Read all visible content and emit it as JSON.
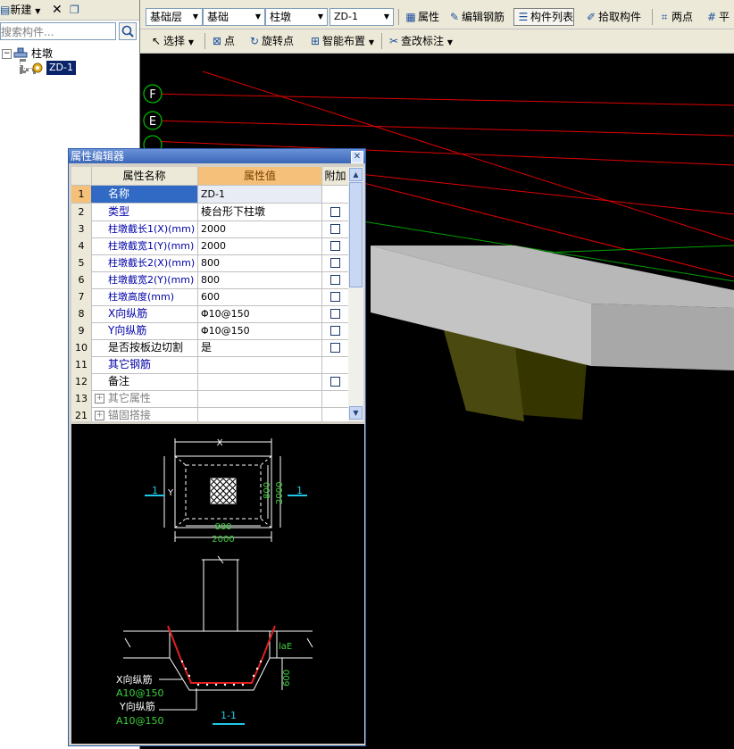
{
  "left_panel": {
    "new_label": "新建",
    "search_placeholder": "搜索构件...",
    "tree": {
      "category": "柱墩",
      "item": "ZD-1"
    }
  },
  "toolbar1": {
    "combo_floor": "基础层",
    "combo_type": "基础",
    "combo_comp": "柱墩",
    "combo_name": "ZD-1",
    "btn_property": "属性",
    "btn_edit_rebar": "编辑钢筋",
    "btn_comp_list": "构件列表",
    "btn_pick": "拾取构件",
    "btn_two_point": "两点",
    "btn_parallel": "平"
  },
  "toolbar2": {
    "btn_select": "选择",
    "btn_point": "点",
    "btn_rotate_point": "旋转点",
    "btn_smart_layout": "智能布置",
    "btn_check_label": "查改标注"
  },
  "axes": [
    "F",
    "E"
  ],
  "prop_editor": {
    "title": "属性编辑器",
    "col_name": "属性名称",
    "col_value": "属性值",
    "col_extra": "附加",
    "rows": [
      {
        "num": "1",
        "name": "名称",
        "value": "ZD-1"
      },
      {
        "num": "2",
        "name": "类型",
        "value": "棱台形下柱墩"
      },
      {
        "num": "3",
        "name": "柱墩截长1(X)(mm)",
        "value": "2000"
      },
      {
        "num": "4",
        "name": "柱墩截宽1(Y)(mm)",
        "value": "2000"
      },
      {
        "num": "5",
        "name": "柱墩截长2(X)(mm)",
        "value": "800"
      },
      {
        "num": "6",
        "name": "柱墩截宽2(Y)(mm)",
        "value": "800"
      },
      {
        "num": "7",
        "name": "柱墩高度(mm)",
        "value": "600"
      },
      {
        "num": "8",
        "name": "X向纵筋",
        "value": "Φ10@150"
      },
      {
        "num": "9",
        "name": "Y向纵筋",
        "value": "Φ10@150"
      },
      {
        "num": "10",
        "name": "是否按板边切割",
        "value": "是"
      },
      {
        "num": "11",
        "name": "其它钢筋",
        "value": ""
      },
      {
        "num": "12",
        "name": "备注",
        "value": ""
      },
      {
        "num": "13",
        "name": "其它属性",
        "value": ""
      },
      {
        "num": "21",
        "name": "锚固搭接",
        "value": ""
      }
    ]
  },
  "drawing": {
    "dim_x": "X",
    "dim_y": "Y",
    "dim_800_h": "800",
    "dim_2000_h": "2000",
    "dim_800_v": "800",
    "dim_2000_v": "2000",
    "section_mark": "1",
    "lae": "laE",
    "dim_600": "600",
    "x_rebar_label": "X向纵筋",
    "x_rebar_value": "A10@150",
    "y_rebar_label": "Y向纵筋",
    "y_rebar_value": "A10@150",
    "section_title": "1-1"
  }
}
